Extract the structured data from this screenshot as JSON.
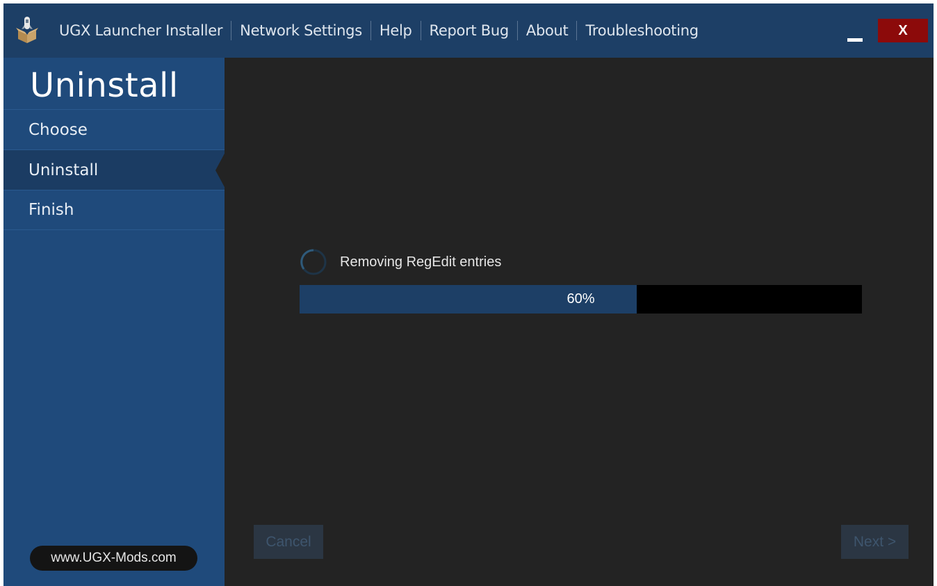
{
  "titlebar": {
    "menu": [
      "UGX Launcher Installer",
      "Network Settings",
      "Help",
      "Report Bug",
      "About",
      "Troubleshooting"
    ],
    "close_label": "X",
    "background_color": "#1d3f66",
    "close_color": "#8c0a0a"
  },
  "sidebar": {
    "title": "Uninstall",
    "items": [
      {
        "label": "Choose",
        "active": false
      },
      {
        "label": "Uninstall",
        "active": true
      },
      {
        "label": "Finish",
        "active": false
      }
    ],
    "website": "www.UGX-Mods.com",
    "background_color": "#1f4a7b"
  },
  "main": {
    "status_text": "Removing RegEdit entries",
    "progress": {
      "percent": 60,
      "label": "60%"
    },
    "cancel_label": "Cancel",
    "next_label": "Next >"
  }
}
